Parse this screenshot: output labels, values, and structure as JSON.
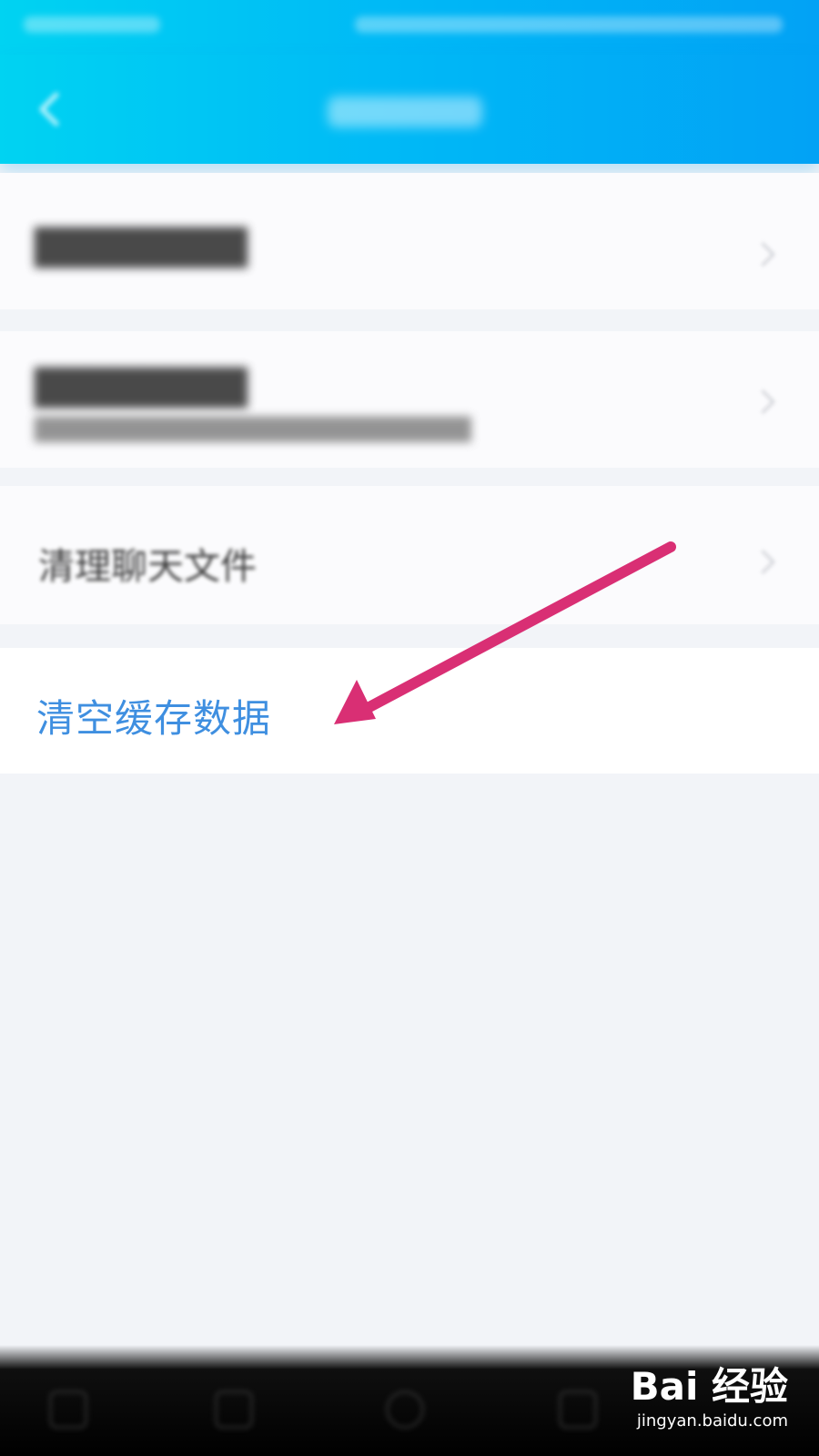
{
  "rows": {
    "chat_files_label": "清理聊天文件",
    "clear_cache_label": "清空缓存数据"
  },
  "colors": {
    "header_gradient_start": "#00d3f2",
    "header_gradient_end": "#02a2f5",
    "accent_text": "#3f8fe0",
    "annotation_arrow": "#d92f74",
    "background": "#f2f4f8"
  },
  "icons": {
    "back": "chevron-left",
    "row_chevron": "chevron-right"
  },
  "watermark": {
    "logo": "Bai 经验",
    "url": "jingyan.baidu.com"
  }
}
